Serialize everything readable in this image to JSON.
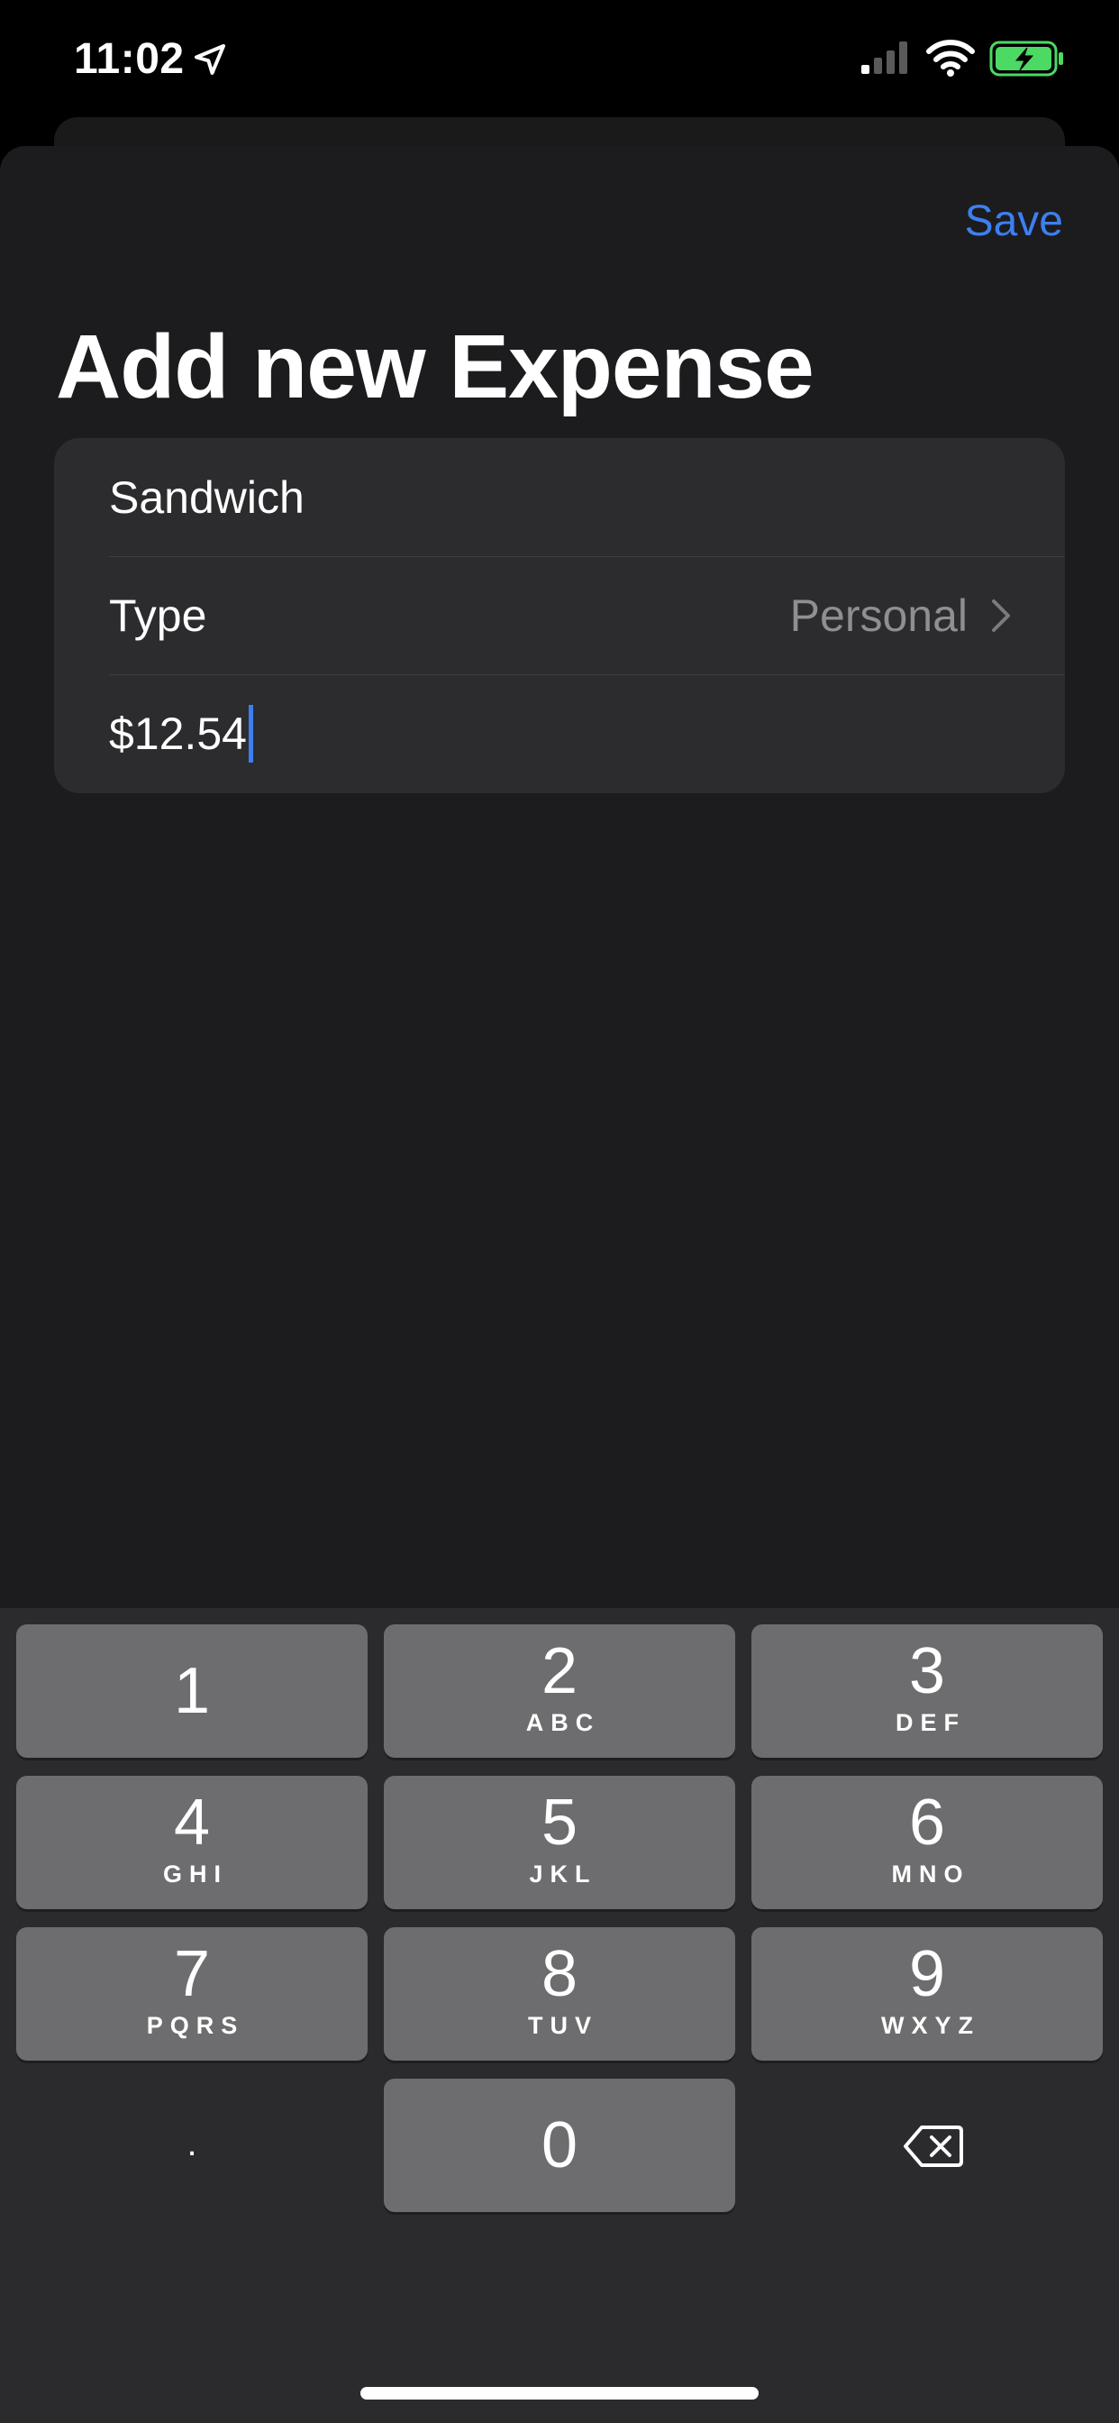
{
  "status_bar": {
    "time": "11:02",
    "icons": [
      "location-arrow-icon",
      "cellular-signal-icon",
      "wifi-icon",
      "battery-charging-icon"
    ]
  },
  "header": {
    "save_label": "Save",
    "title": "Add new Expense"
  },
  "form": {
    "name_value": "Sandwich",
    "type_label": "Type",
    "type_value": "Personal",
    "amount_value": "$12.54"
  },
  "keyboard": {
    "keys": [
      {
        "digit": "1",
        "letters": ""
      },
      {
        "digit": "2",
        "letters": "ABC"
      },
      {
        "digit": "3",
        "letters": "DEF"
      },
      {
        "digit": "4",
        "letters": "GHI"
      },
      {
        "digit": "5",
        "letters": "JKL"
      },
      {
        "digit": "6",
        "letters": "MNO"
      },
      {
        "digit": "7",
        "letters": "PQRS"
      },
      {
        "digit": "8",
        "letters": "TUV"
      },
      {
        "digit": "9",
        "letters": "WXYZ"
      }
    ],
    "decimal_label": ".",
    "zero_label": "0"
  },
  "colors": {
    "accent": "#3d7ff0",
    "sheet_background": "#1c1c1e",
    "group_background": "#2c2c2e",
    "key_background": "#6d6d6f",
    "battery_fill": "#4cd964"
  }
}
